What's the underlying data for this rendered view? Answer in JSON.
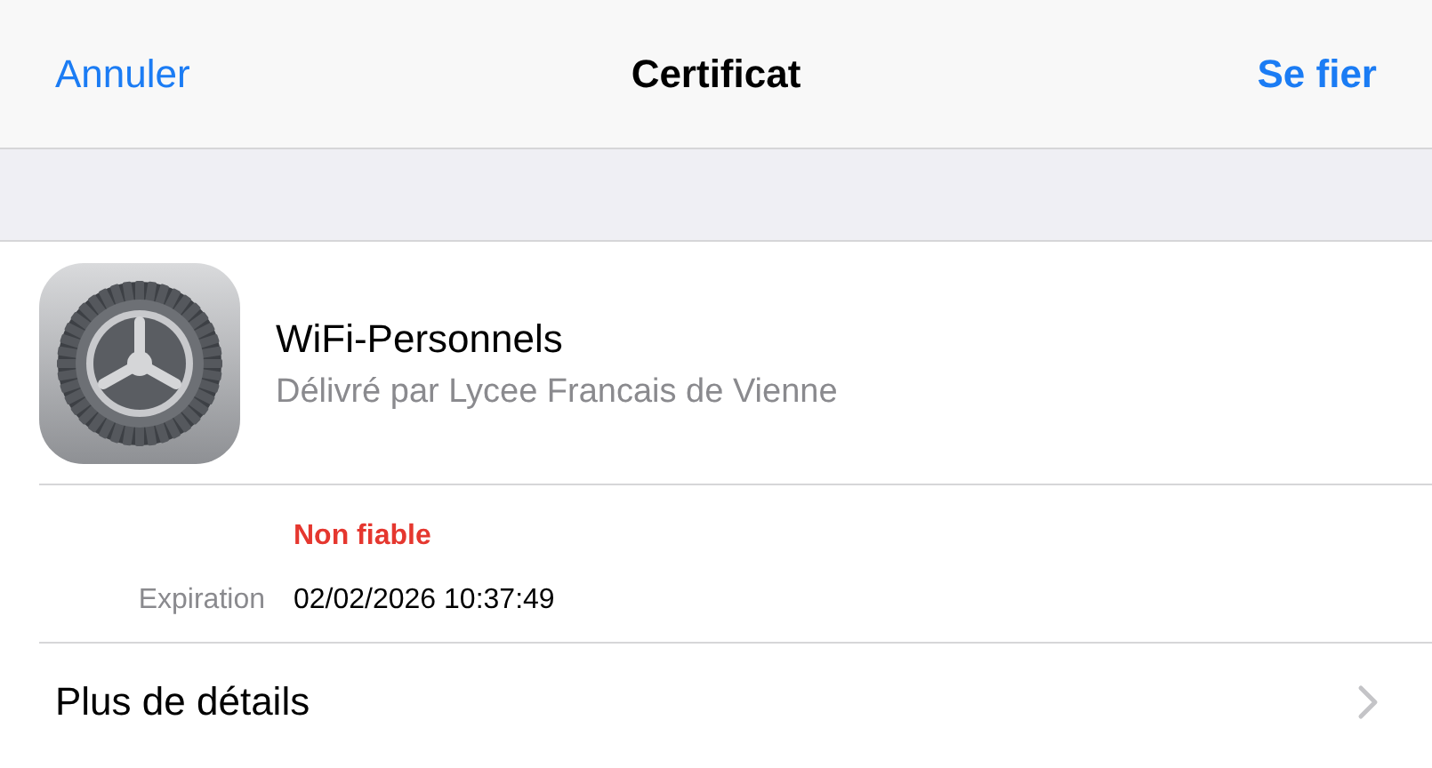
{
  "nav": {
    "cancel": "Annuler",
    "title": "Certificat",
    "trust": "Se fier"
  },
  "certificate": {
    "name": "WiFi-Personnels",
    "issuer": "Délivré par Lycee Francais de Vienne"
  },
  "status": {
    "text": "Non fiable",
    "trusted": false
  },
  "details": [
    {
      "label": "Expiration",
      "value": "02/02/2026 10:37:49"
    }
  ],
  "more": {
    "label": "Plus de détails"
  }
}
